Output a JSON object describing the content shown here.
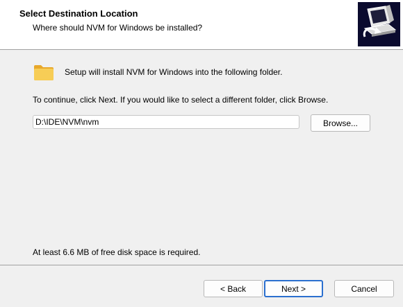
{
  "header": {
    "title": "Select Destination Location",
    "subtitle": "Where should NVM for Windows be installed?",
    "image_icon": "computer-install-icon"
  },
  "main": {
    "folder_icon": "folder-icon",
    "intro": "Setup will install NVM for Windows into the following folder.",
    "instruction": "To continue, click Next. If you would like to select a different folder, click Browse.",
    "path_value": "D:\\IDE\\NVM\\nvm",
    "browse_label": "Browse...",
    "space_required": "At least 6.6 MB of free disk space is required."
  },
  "footer": {
    "back_label": "< Back",
    "next_label": "Next >",
    "cancel_label": "Cancel"
  },
  "colors": {
    "header_bg": "#ffffff",
    "body_bg": "#f0f0f0",
    "folder": "#f4c24a",
    "focus_border": "#2a6fcf"
  }
}
